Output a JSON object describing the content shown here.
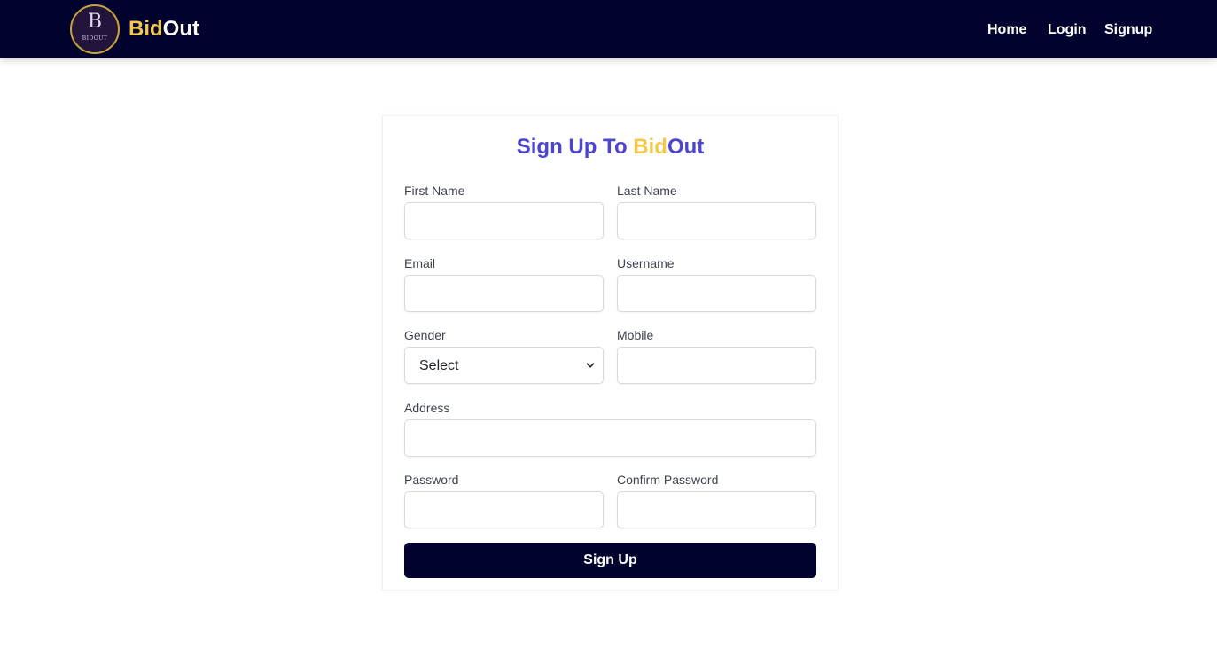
{
  "header": {
    "logo_letter": "B",
    "logo_small_text": "BIDOUT",
    "brand_part1": "Bid",
    "brand_part2": "Out",
    "nav": {
      "home": "Home",
      "login": "Login",
      "signup": "Signup"
    }
  },
  "form": {
    "title_prefix": "Sign Up To ",
    "title_bid": "Bid",
    "title_out": "Out",
    "fields": {
      "first_name": {
        "label": "First Name",
        "value": ""
      },
      "last_name": {
        "label": "Last Name",
        "value": ""
      },
      "email": {
        "label": "Email",
        "value": ""
      },
      "username": {
        "label": "Username",
        "value": ""
      },
      "gender": {
        "label": "Gender",
        "selected": "Select"
      },
      "mobile": {
        "label": "Mobile",
        "value": ""
      },
      "address": {
        "label": "Address",
        "value": ""
      },
      "password": {
        "label": "Password",
        "value": ""
      },
      "confirm_password": {
        "label": "Confirm Password",
        "value": ""
      }
    },
    "submit_label": "Sign Up"
  },
  "colors": {
    "navbar": "#02022f",
    "accent_yellow": "#f3c94d",
    "title_purple": "#4d45cf",
    "button": "#02022f"
  }
}
